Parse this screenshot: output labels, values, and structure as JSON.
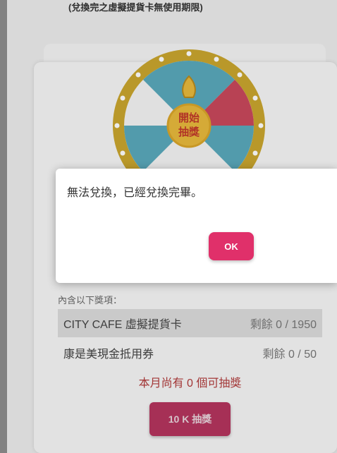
{
  "header": {
    "note": "(兌換完之虛擬提貨卡無使用期限)"
  },
  "wheel": {
    "center_label_line1": "開始",
    "center_label_line2": "抽獎",
    "colors": {
      "rim": "#c9a52e",
      "teal": "#5aa9bb",
      "white": "#f4f4f4",
      "red": "#c8485c",
      "center": "#e8b93c",
      "center_text": "#c0392b"
    }
  },
  "prizes": {
    "header": "內含以下獎項：",
    "items": [
      {
        "name": "CITY CAFE 虛擬提貨卡",
        "remaining": "剩餘 0 / 1950"
      },
      {
        "name": "康是美現金抵用券",
        "remaining": "剩餘 0 / 50"
      }
    ]
  },
  "status": {
    "remaining_draws": "本月尚有 0 個可抽獎"
  },
  "draw_button": {
    "label": "10 K 抽獎"
  },
  "dialog": {
    "message": "無法兌換，已經兌換完畢。",
    "ok_label": "OK"
  }
}
